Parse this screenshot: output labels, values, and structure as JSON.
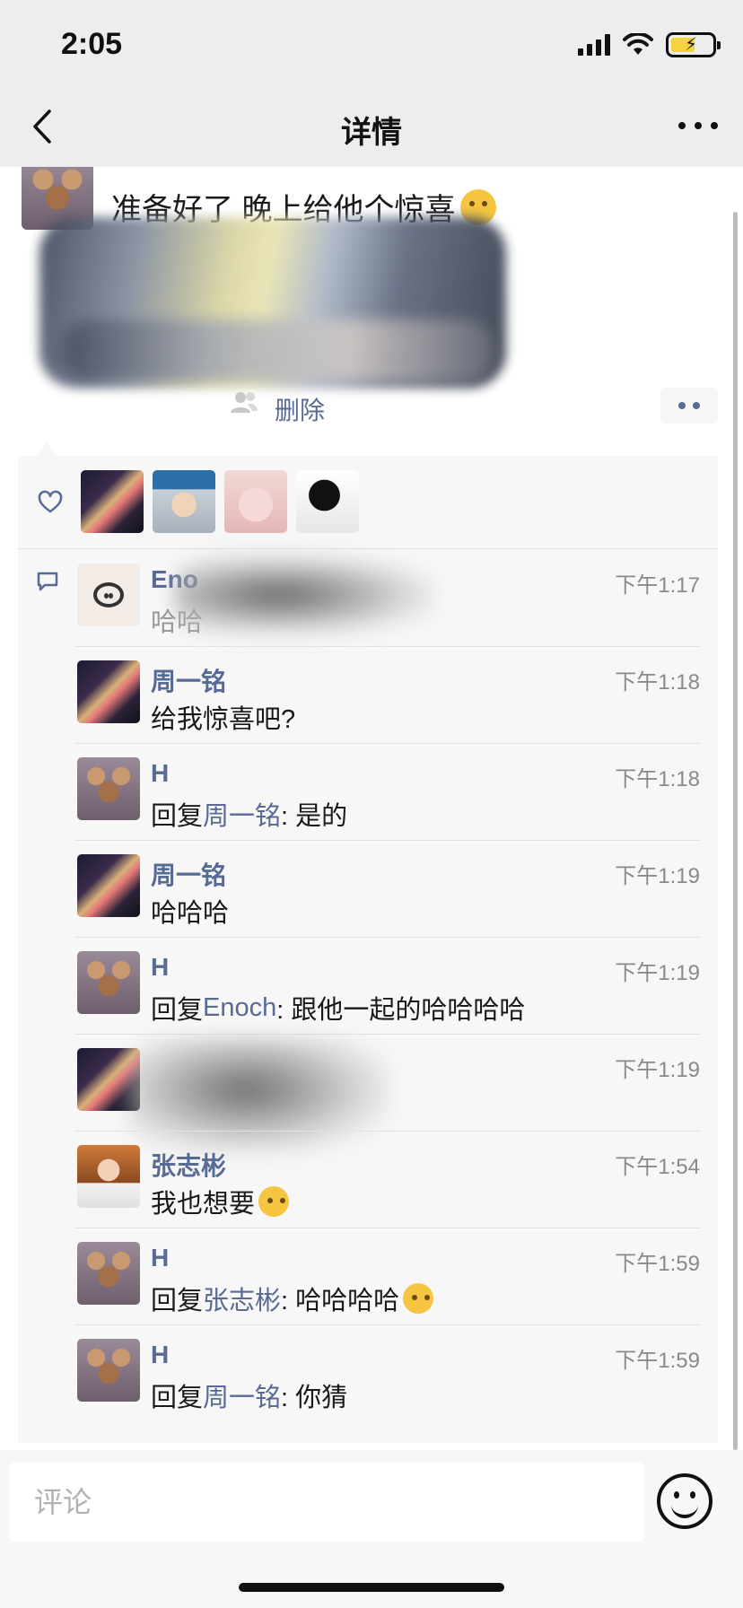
{
  "status_bar": {
    "time": "2:05"
  },
  "nav": {
    "title": "详情"
  },
  "post": {
    "text": "准备好了 晚上给他个惊喜",
    "delete_label": "删除"
  },
  "likes": {
    "avatars": [
      "avatar-zhou",
      "avatar-boy",
      "avatar-girl",
      "avatar-sketch"
    ]
  },
  "comments": [
    {
      "name": "Eno",
      "time": "下午1:17",
      "text": "哈哈"
    },
    {
      "name": "周一铭",
      "time": "下午1:18",
      "text": "给我惊喜吧?"
    },
    {
      "name": "H",
      "time": "下午1:18",
      "reply_word": "回复",
      "reply_to": "周一铭",
      "text": ": 是的"
    },
    {
      "name": "周一铭",
      "time": "下午1:19",
      "text": "哈哈哈"
    },
    {
      "name": "H",
      "time": "下午1:19",
      "reply_word": "回复",
      "reply_to": "Enoch",
      "text": ": 跟他一起的哈哈哈哈"
    },
    {
      "name": "",
      "time": "下午1:19",
      "text": ""
    },
    {
      "name": "张志彬",
      "time": "下午1:54",
      "text": "我也想要"
    },
    {
      "name": "H",
      "time": "下午1:59",
      "reply_word": "回复",
      "reply_to": "张志彬",
      "text": ": 哈哈哈哈"
    },
    {
      "name": "H",
      "time": "下午1:59",
      "reply_word": "回复",
      "reply_to": "周一铭",
      "text": ": 你猜"
    }
  ],
  "input": {
    "placeholder": "评论"
  },
  "icons": {
    "back": "chevron-left-icon",
    "more": "more-dots-icon",
    "like": "heart-icon",
    "comment": "comment-bubble-icon",
    "emoji": "emoji-icon"
  },
  "colors": {
    "link": "#576b95",
    "background": "#ededed",
    "panel": "#f7f7f7"
  }
}
